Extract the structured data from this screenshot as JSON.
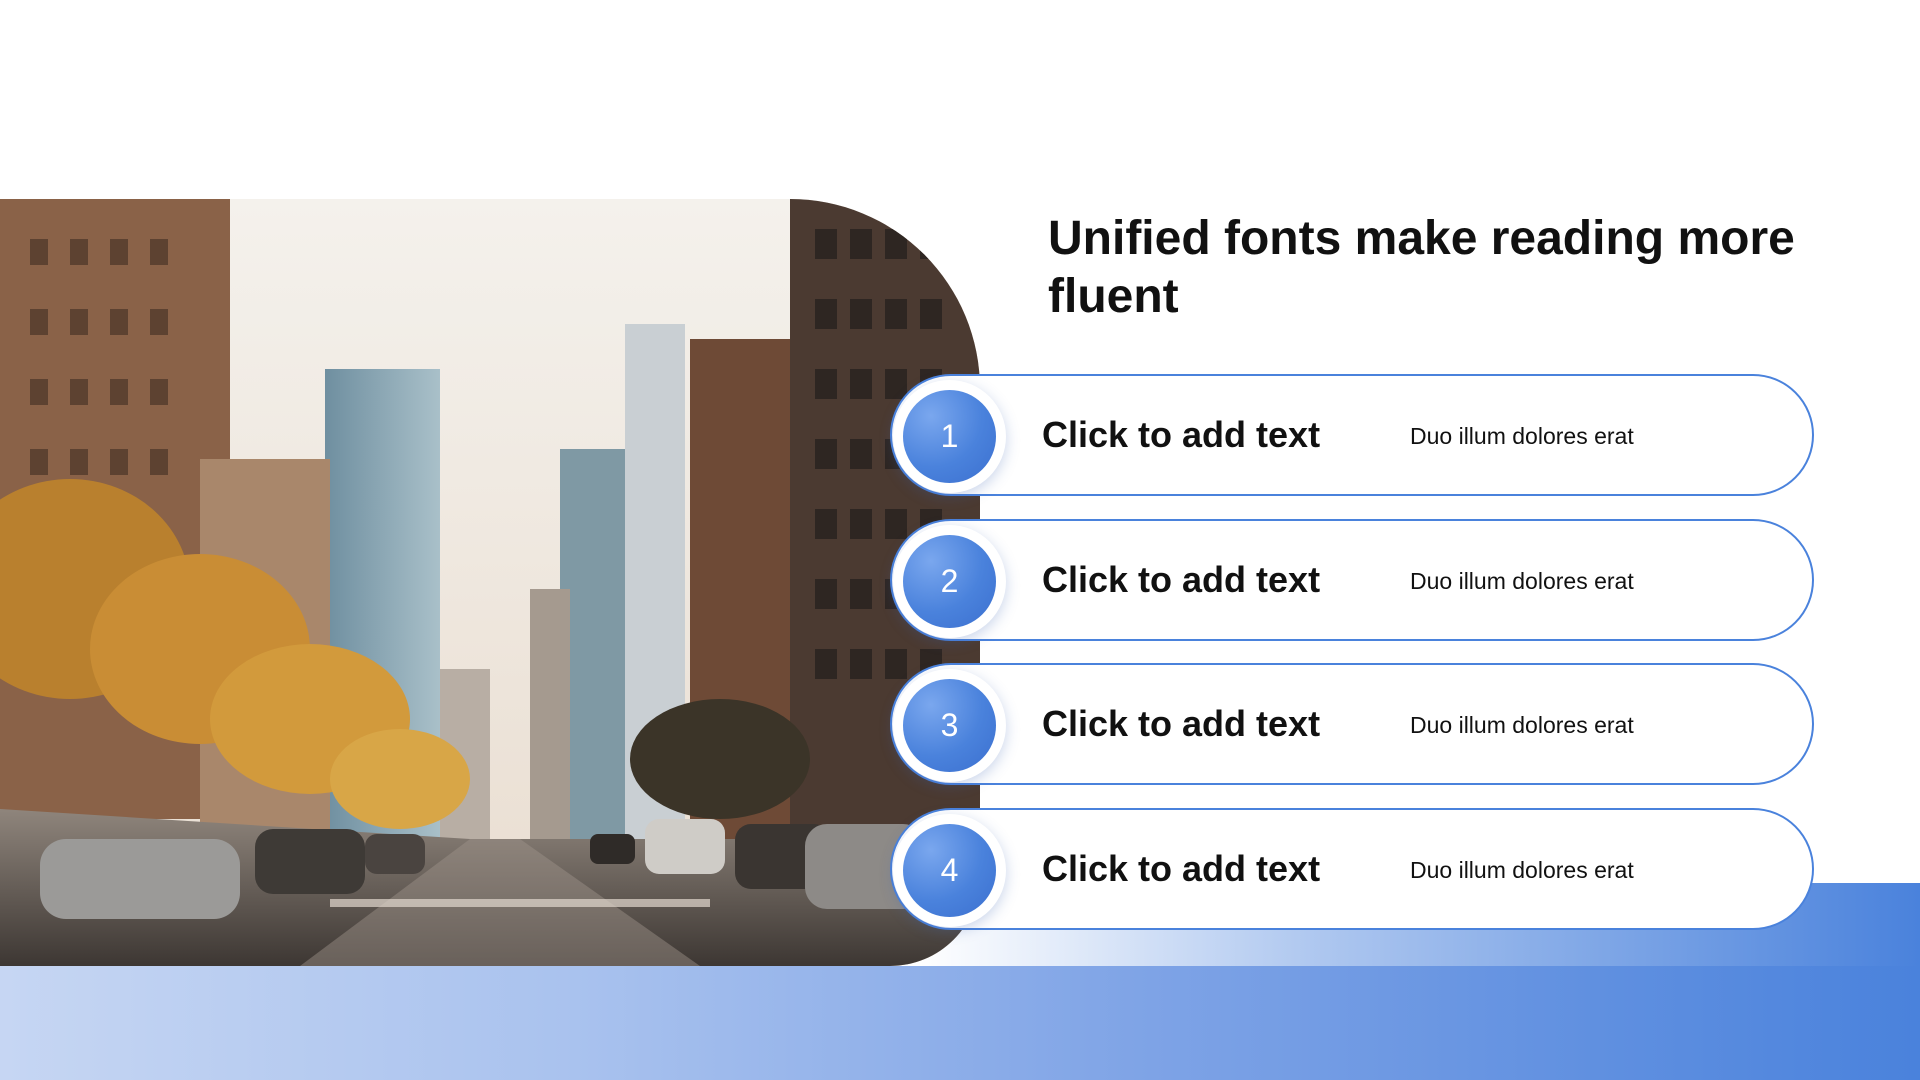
{
  "slide": {
    "title": "Unified fonts make reading more fluent",
    "photo_icon": "city-street-photo",
    "items": [
      {
        "number": "1",
        "heading": "Click to add text",
        "description": "Duo illum dolores erat"
      },
      {
        "number": "2",
        "heading": "Click to add text",
        "description": "Duo illum dolores erat"
      },
      {
        "number": "3",
        "heading": "Click to add text",
        "description": "Duo illum dolores erat"
      },
      {
        "number": "4",
        "heading": "Click to add text",
        "description": "Duo illum dolores erat"
      }
    ]
  },
  "colors": {
    "accent": "#4a82dc",
    "band_light": "#c6d6f3",
    "text": "#111111",
    "background": "#ffffff"
  }
}
